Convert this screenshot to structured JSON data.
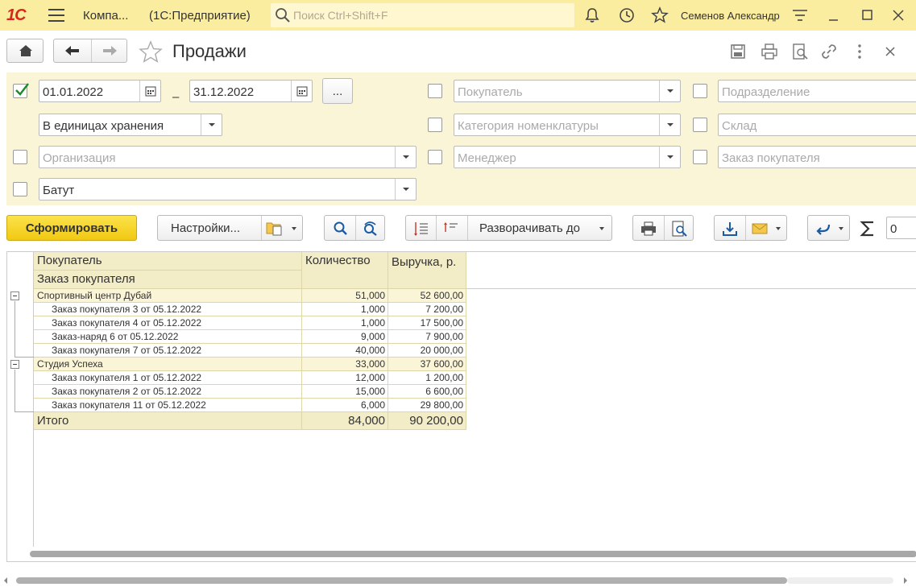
{
  "topbar": {
    "logo": "1С",
    "app_short": "Компа...",
    "app_platform": "(1С:Предприятие)",
    "search_placeholder": "Поиск Ctrl+Shift+F",
    "user": "Семенов Александр"
  },
  "header": {
    "title": "Продажи"
  },
  "filters": {
    "date_from": "01.01.2022",
    "date_to": "31.12.2022",
    "period_dash": "–",
    "more_label": "...",
    "units": "В единицах хранения",
    "organization_placeholder": "Организация",
    "product": "Батут",
    "buyer_placeholder": "Покупатель",
    "category_placeholder": "Категория номенклатуры",
    "manager_placeholder": "Менеджер",
    "division_placeholder": "Подразделение",
    "warehouse_placeholder": "Склад",
    "order_placeholder": "Заказ покупателя",
    "period_checked": true
  },
  "toolbar": {
    "generate": "Сформировать",
    "settings": "Настройки...",
    "expand_to": "Разворачивать до",
    "sum_value": "0"
  },
  "report": {
    "headers": {
      "col1_top": "Покупатель",
      "col1_bottom": "Заказ покупателя",
      "col2": "Количество",
      "col3": "Выручка, р."
    },
    "rows": [
      {
        "level": 0,
        "name": "Спортивный центр Дубай",
        "qty": "51,000",
        "revenue": "52 600,00"
      },
      {
        "level": 1,
        "name": "Заказ покупателя 3 от 05.12.2022",
        "qty": "1,000",
        "revenue": "7 200,00"
      },
      {
        "level": 1,
        "name": "Заказ покупателя 4 от 05.12.2022",
        "qty": "1,000",
        "revenue": "17 500,00"
      },
      {
        "level": 1,
        "name": "Заказ-наряд 6 от 05.12.2022",
        "qty": "9,000",
        "revenue": "7 900,00"
      },
      {
        "level": 1,
        "name": "Заказ покупателя 7 от 05.12.2022",
        "qty": "40,000",
        "revenue": "20 000,00"
      },
      {
        "level": 0,
        "name": "Студия Успеха",
        "qty": "33,000",
        "revenue": "37 600,00"
      },
      {
        "level": 1,
        "name": "Заказ покупателя 1 от 05.12.2022",
        "qty": "12,000",
        "revenue": "1 200,00"
      },
      {
        "level": 1,
        "name": "Заказ покупателя 2 от 05.12.2022",
        "qty": "15,000",
        "revenue": "6 600,00"
      },
      {
        "level": 1,
        "name": "Заказ покупателя 11 от 05.12.2022",
        "qty": "6,000",
        "revenue": "29 800,00"
      }
    ],
    "total": {
      "label": "Итого",
      "qty": "84,000",
      "revenue": "90 200,00"
    }
  },
  "colors": {
    "topbar_bg": "#fbeda0",
    "filter_bg": "#fbf5d8",
    "primary_button": "#f2c813",
    "header_cell": "#f2ecc7",
    "logo_red": "#d8261b"
  }
}
